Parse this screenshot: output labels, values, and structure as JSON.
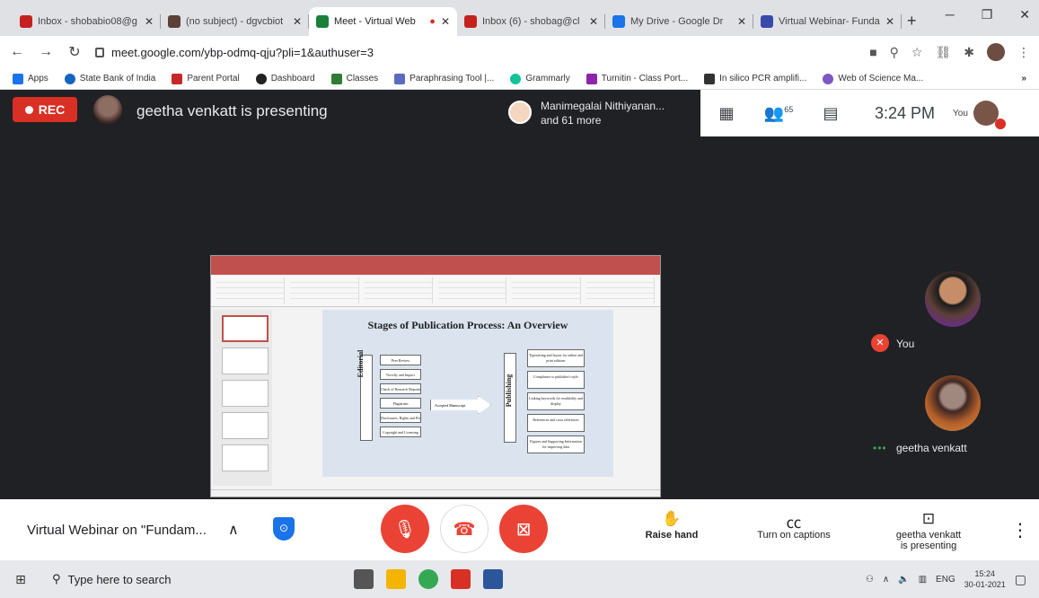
{
  "tabs": [
    {
      "title": "Inbox - shobabio08@g",
      "favicon_color": "#c5221f",
      "active": false
    },
    {
      "title": "(no subject) - dgvcbiot",
      "favicon_color": "#5d4037",
      "active": false
    },
    {
      "title": "Meet - Virtual Web",
      "favicon_color": "#188038",
      "active": true
    },
    {
      "title": "Inbox (6) - shobag@cl",
      "favicon_color": "#c5221f",
      "active": false
    },
    {
      "title": "My Drive - Google Dr",
      "favicon_color": "#1a73e8",
      "active": false
    },
    {
      "title": "Virtual Webinar- Funda",
      "favicon_color": "#3949ab",
      "active": false
    }
  ],
  "new_tab": "+",
  "address": "meet.google.com/ybp-odmq-qju?pli=1&authuser=3",
  "bookmarks": [
    {
      "label": "Apps",
      "color": "#1a73e8"
    },
    {
      "label": "State Bank of India",
      "color": "#1565c0"
    },
    {
      "label": "Parent Portal",
      "color": "#c62828"
    },
    {
      "label": "Dashboard",
      "color": "#222222"
    },
    {
      "label": "Classes",
      "color": "#2e7d32"
    },
    {
      "label": "Paraphrasing Tool |...",
      "color": "#5c6bc0"
    },
    {
      "label": "Grammarly",
      "color": "#15c39a"
    },
    {
      "label": "Turnitin - Class Port...",
      "color": "#8e24aa"
    },
    {
      "label": "In silico PCR amplifi...",
      "color": "#333333"
    },
    {
      "label": "Web of Science Ma...",
      "color": "#7e57c2"
    }
  ],
  "meet": {
    "rec_label": "REC",
    "presenting_text": "geetha venkatt is presenting",
    "others_name": "Manimegalai Nithiyanan...",
    "others_more": "and 61 more",
    "participant_count": "65",
    "time": "3:24 PM",
    "you_label": "You",
    "tiles": [
      {
        "name": "You"
      },
      {
        "name": "geetha venkatt",
        "dots": "•••"
      }
    ],
    "slide": {
      "heading": "Stages of Publication Process: An Overview",
      "editorial_label": "Editorial",
      "publishing_label": "Publishing",
      "arrow_label": "Accepted Manuscript",
      "editorial_stages": [
        "Peer Review",
        "Novelty and Impact",
        "Check of Research Reporting",
        "Plagiarism",
        "Disclosures, Rights and Permissions",
        "Copyright and Licensing"
      ],
      "publishing_stages": [
        "Typesetting and layout for online and print editions",
        "Compliance to publisher's style",
        "Linking keywords for readability and display",
        "References and cross references",
        "Figures and Supporting Information for improving data"
      ]
    }
  },
  "bottom": {
    "meeting_title": "Virtual Webinar on \"Fundam...",
    "raise_hand": "Raise hand",
    "captions": "Turn on captions",
    "present_line1": "geetha venkatt",
    "present_line2": "is presenting"
  },
  "taskbar": {
    "search_placeholder": "Type here to search",
    "lang": "ENG",
    "time": "15:24",
    "date": "30-01-2021",
    "app_colors": [
      "#555555",
      "#f4b400",
      "#34a853",
      "#d93025",
      "#2b579a"
    ]
  }
}
